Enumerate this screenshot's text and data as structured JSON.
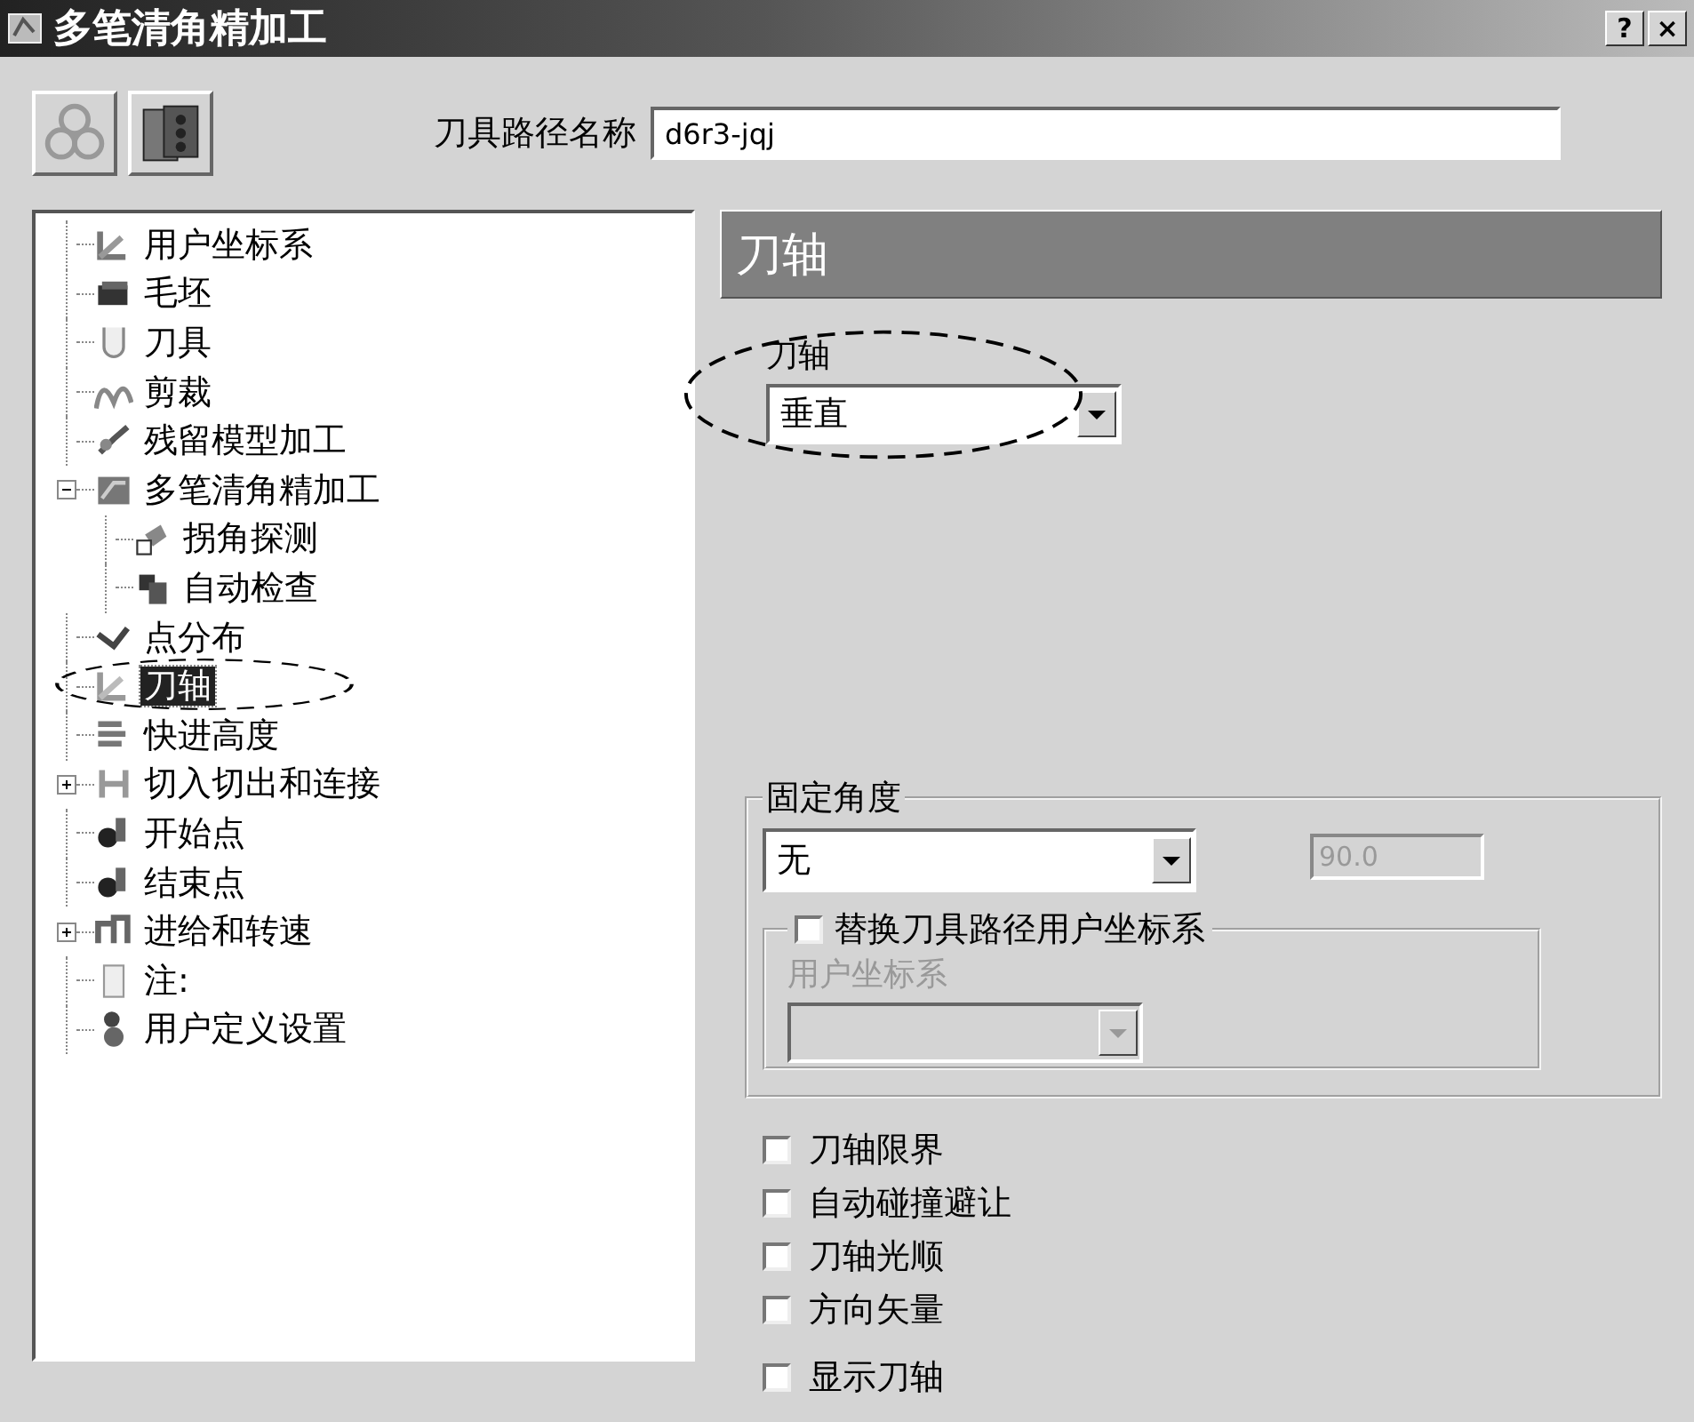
{
  "window": {
    "title": "多笔清角精加工",
    "buttons": [
      "?",
      "×"
    ]
  },
  "toolpath_name": {
    "label": "刀具路径名称",
    "value": "d6r3-jqj"
  },
  "tree": [
    {
      "label": "用户坐标系",
      "selected": false
    },
    {
      "label": "毛坯",
      "selected": false
    },
    {
      "label": "刀具",
      "selected": false
    },
    {
      "label": "剪裁",
      "selected": false
    },
    {
      "label": "残留模型加工",
      "selected": false
    },
    {
      "label": "多笔清角精加工",
      "selected": false,
      "expanded": true,
      "children": [
        {
          "label": "拐角探测",
          "selected": false
        },
        {
          "label": "自动检查",
          "selected": false
        }
      ]
    },
    {
      "label": "点分布",
      "selected": false
    },
    {
      "label": "刀轴",
      "selected": true
    },
    {
      "label": "快进高度",
      "selected": false
    },
    {
      "label": "切入切出和连接",
      "selected": false,
      "expanded": false
    },
    {
      "label": "开始点",
      "selected": false
    },
    {
      "label": "结束点",
      "selected": false
    },
    {
      "label": "进给和转速",
      "selected": false,
      "expanded": false
    },
    {
      "label": "注:",
      "selected": false
    },
    {
      "label": "用户定义设置",
      "selected": false
    }
  ],
  "panel": {
    "title": "刀轴",
    "tool_axis": {
      "label": "刀轴",
      "value": "垂直"
    },
    "fixed_angle": {
      "title": "固定角度",
      "value": "无",
      "angle": "90.0",
      "angle_disabled": true,
      "replace_ucs": {
        "label": "替换刀具路径用户坐标系",
        "checked": false,
        "ucs_label": "用户坐标系",
        "disabled": true
      }
    },
    "options": [
      {
        "label": "刀轴限界",
        "checked": false
      },
      {
        "label": "自动碰撞避让",
        "checked": false
      },
      {
        "label": "刀轴光顺",
        "checked": false
      },
      {
        "label": "方向矢量",
        "checked": false
      }
    ],
    "display_options": [
      {
        "label": "显示刀轴",
        "checked": false
      }
    ]
  }
}
